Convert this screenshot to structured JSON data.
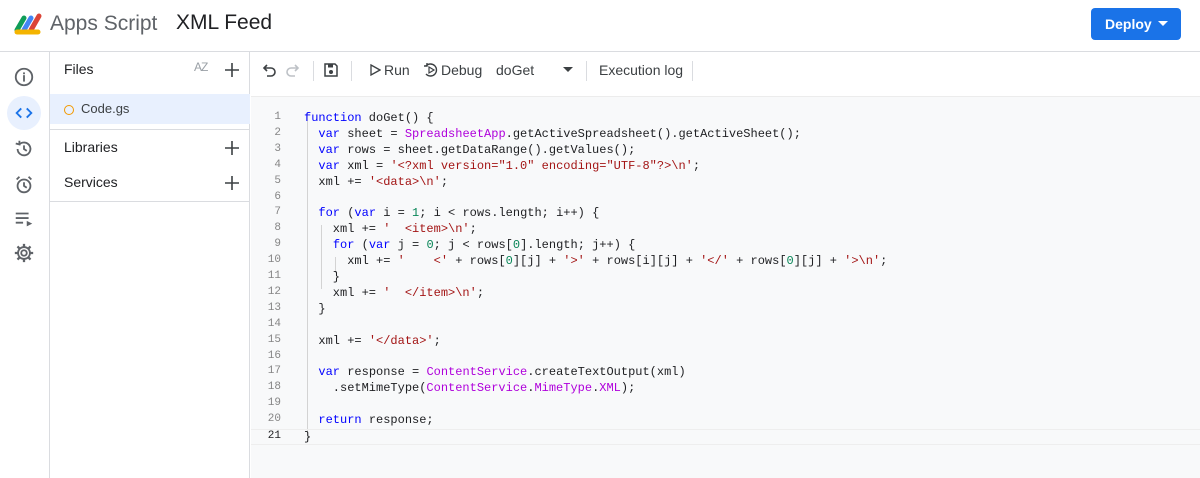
{
  "header": {
    "app_name": "Apps Script",
    "project_title": "XML Feed",
    "deploy_label": "Deploy",
    "brand_color": "#1a73e8"
  },
  "rail": {
    "icons": [
      "info-icon",
      "code-icon",
      "history-icon",
      "alarm-icon",
      "executions-icon",
      "gear-icon"
    ],
    "active": "code-icon"
  },
  "files_panel": {
    "files_title": "Files",
    "sort_label": "AZ",
    "files": [
      {
        "name": "Code.gs"
      }
    ],
    "libraries_title": "Libraries",
    "services_title": "Services"
  },
  "toolbar": {
    "run_label": "Run",
    "debug_label": "Debug",
    "function_selected": "doGet",
    "execution_log_label": "Execution log"
  },
  "editor": {
    "current_line": 21,
    "lines": [
      {
        "n": "1",
        "tokens": [
          [
            "kw",
            "function"
          ],
          [
            "plain",
            " doGet() {"
          ]
        ]
      },
      {
        "n": "2",
        "tokens": [
          [
            "plain",
            "  "
          ],
          [
            "kw",
            "var"
          ],
          [
            "plain",
            " sheet = "
          ],
          [
            "cls",
            "SpreadsheetApp"
          ],
          [
            "plain",
            ".getActiveSpreadsheet().getActiveSheet();"
          ]
        ]
      },
      {
        "n": "3",
        "tokens": [
          [
            "plain",
            "  "
          ],
          [
            "kw",
            "var"
          ],
          [
            "plain",
            " rows = sheet.getDataRange().getValues();"
          ]
        ]
      },
      {
        "n": "4",
        "tokens": [
          [
            "plain",
            "  "
          ],
          [
            "kw",
            "var"
          ],
          [
            "plain",
            " xml = "
          ],
          [
            "str",
            "'<?xml version=\"1.0\" encoding=\"UTF-8\"?>\\n'"
          ],
          [
            "plain",
            ";"
          ]
        ]
      },
      {
        "n": "5",
        "tokens": [
          [
            "plain",
            "  xml += "
          ],
          [
            "str",
            "'<data>\\n'"
          ],
          [
            "plain",
            ";"
          ]
        ]
      },
      {
        "n": "6",
        "tokens": []
      },
      {
        "n": "7",
        "tokens": [
          [
            "plain",
            "  "
          ],
          [
            "kw",
            "for"
          ],
          [
            "plain",
            " ("
          ],
          [
            "kw",
            "var"
          ],
          [
            "plain",
            " i = "
          ],
          [
            "num",
            "1"
          ],
          [
            "plain",
            "; i < rows.length; i++) {"
          ]
        ]
      },
      {
        "n": "8",
        "tokens": [
          [
            "plain",
            "    xml += "
          ],
          [
            "str",
            "'  <item>\\n'"
          ],
          [
            "plain",
            ";"
          ]
        ]
      },
      {
        "n": "9",
        "tokens": [
          [
            "plain",
            "    "
          ],
          [
            "kw",
            "for"
          ],
          [
            "plain",
            " ("
          ],
          [
            "kw",
            "var"
          ],
          [
            "plain",
            " j = "
          ],
          [
            "num",
            "0"
          ],
          [
            "plain",
            "; j < rows["
          ],
          [
            "num",
            "0"
          ],
          [
            "plain",
            "].length; j++) {"
          ]
        ]
      },
      {
        "n": "10",
        "tokens": [
          [
            "plain",
            "      xml += "
          ],
          [
            "str",
            "'    <'"
          ],
          [
            "plain",
            " + rows["
          ],
          [
            "num",
            "0"
          ],
          [
            "plain",
            "][j] + "
          ],
          [
            "str",
            "'>'"
          ],
          [
            "plain",
            " + rows[i][j] + "
          ],
          [
            "str",
            "'</'"
          ],
          [
            "plain",
            " + rows["
          ],
          [
            "num",
            "0"
          ],
          [
            "plain",
            "][j] + "
          ],
          [
            "str",
            "'>\\n'"
          ],
          [
            "plain",
            ";"
          ]
        ]
      },
      {
        "n": "11",
        "tokens": [
          [
            "plain",
            "    }"
          ]
        ]
      },
      {
        "n": "12",
        "tokens": [
          [
            "plain",
            "    xml += "
          ],
          [
            "str",
            "'  </item>\\n'"
          ],
          [
            "plain",
            ";"
          ]
        ]
      },
      {
        "n": "13",
        "tokens": [
          [
            "plain",
            "  }"
          ]
        ]
      },
      {
        "n": "14",
        "tokens": []
      },
      {
        "n": "15",
        "tokens": [
          [
            "plain",
            "  xml += "
          ],
          [
            "str",
            "'</data>'"
          ],
          [
            "plain",
            ";"
          ]
        ]
      },
      {
        "n": "16",
        "tokens": []
      },
      {
        "n": "17",
        "tokens": [
          [
            "plain",
            "  "
          ],
          [
            "kw",
            "var"
          ],
          [
            "plain",
            " response = "
          ],
          [
            "cls",
            "ContentService"
          ],
          [
            "plain",
            ".createTextOutput(xml)"
          ]
        ]
      },
      {
        "n": "18",
        "tokens": [
          [
            "plain",
            "    .setMimeType("
          ],
          [
            "cls",
            "ContentService"
          ],
          [
            "plain",
            "."
          ],
          [
            "cls",
            "MimeType"
          ],
          [
            "plain",
            "."
          ],
          [
            "cls",
            "XML"
          ],
          [
            "plain",
            ");"
          ]
        ]
      },
      {
        "n": "19",
        "tokens": []
      },
      {
        "n": "20",
        "tokens": [
          [
            "plain",
            "  "
          ],
          [
            "kw",
            "return"
          ],
          [
            "plain",
            " response;"
          ]
        ]
      },
      {
        "n": "21",
        "tokens": [
          [
            "plain",
            "}"
          ]
        ]
      }
    ]
  }
}
